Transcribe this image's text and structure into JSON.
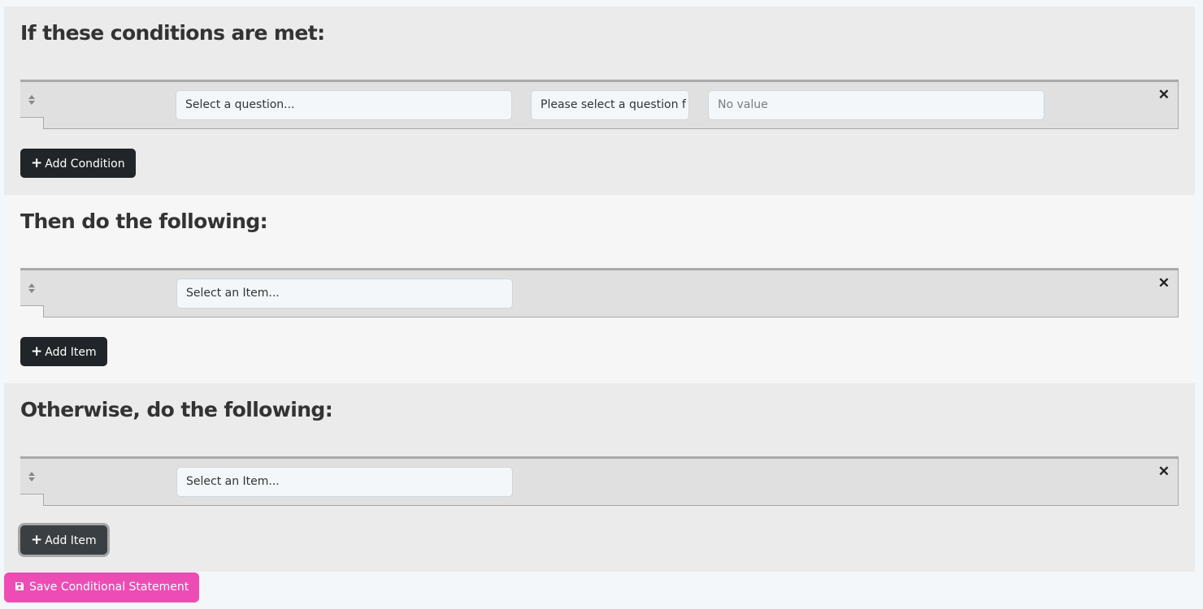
{
  "conditions_section": {
    "title": "If these conditions are met:",
    "row": {
      "question_value": "Select a question...",
      "operator_value": "Please select a question f",
      "value_placeholder": "No value"
    },
    "add_button_label": "Add Condition"
  },
  "then_section": {
    "title": "Then do the following:",
    "row": {
      "item_value": "Select an Item..."
    },
    "add_button_label": "Add Item"
  },
  "otherwise_section": {
    "title": "Otherwise, do the following:",
    "row": {
      "item_value": "Select an Item..."
    },
    "add_button_label": "Add Item"
  },
  "save_button_label": "Save Conditional Statement",
  "icons": {
    "remove": "close-icon",
    "drag": "sort-handle-icon",
    "add": "plus-icon",
    "save": "floppy-disk-icon"
  },
  "colors": {
    "dark_button": "#212529",
    "save_button": "#ee4cb5",
    "section_alt": "#ebebeb"
  }
}
